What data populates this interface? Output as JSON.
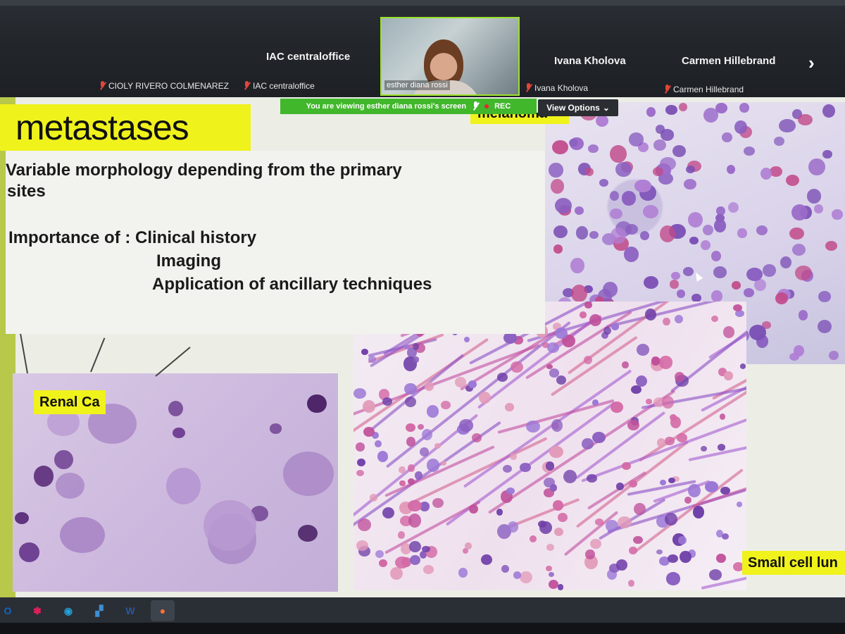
{
  "top_bar": {
    "participants": [
      {
        "name": "IAC centraloffice",
        "label": ""
      },
      {
        "name": "",
        "label": "CIOLY RIVERO COLMENAREZ"
      },
      {
        "name": "",
        "label": "IAC centraloffice"
      },
      {
        "name": "Ivana Kholova",
        "label": "Ivana Kholova"
      },
      {
        "name": "Carmen Hillebrand",
        "label": "Carmen Hillebrand"
      }
    ],
    "active_speaker": "esther diana rossi",
    "next_icon": "chevron-right-icon"
  },
  "screen_share": {
    "viewing_text": "You are viewing  esther diana rossi's screen",
    "rec_label": "REC",
    "view_options_label": "View Options"
  },
  "slide": {
    "title": "metastases",
    "top_right_label": "melanoma",
    "lines": [
      "Variable morphology depending from the primary",
      "sites",
      "Importance of : Clinical history",
      "Imaging",
      "Application of ancillary techniques"
    ],
    "renal_label": "Renal Ca",
    "small_cell_label": "Small cell lun"
  },
  "taskbar": {
    "icons": [
      "outlook-icon",
      "slack-icon",
      "webex-icon",
      "files-icon",
      "word-icon",
      "firefox-icon"
    ],
    "icon_glyphs": [
      "O",
      "✽",
      "◉",
      "▞",
      "W",
      "●"
    ],
    "icon_colors": [
      "#1565c0",
      "#e01e5a",
      "#22a0d8",
      "#3d8fd1",
      "#2b579a",
      "#ff7139"
    ]
  },
  "colors": {
    "highlight_yellow": "#f0f21c",
    "share_green": "#41b72c",
    "muted_red": "#e0463a"
  }
}
